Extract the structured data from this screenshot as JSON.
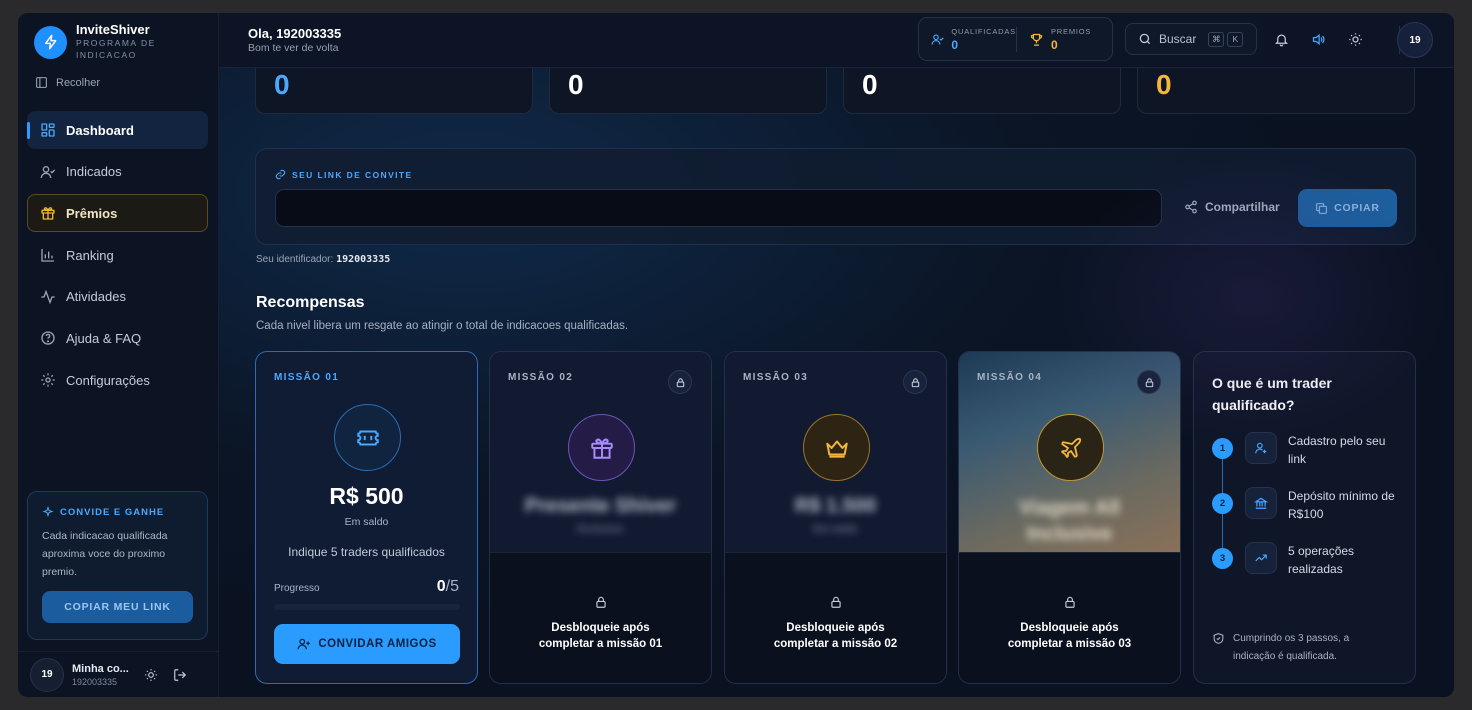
{
  "brand": {
    "name": "InviteShiver",
    "subtitle": "PROGRAMA DE INDICACAO"
  },
  "sidebar": {
    "collapse_label": "Recolher",
    "items": [
      {
        "label": "Dashboard",
        "icon": "grid-icon"
      },
      {
        "label": "Indicados",
        "icon": "user-check-icon"
      },
      {
        "label": "Prêmios",
        "icon": "gift-icon"
      },
      {
        "label": "Ranking",
        "icon": "bar-chart-icon"
      },
      {
        "label": "Atividades",
        "icon": "activity-icon"
      },
      {
        "label": "Ajuda & FAQ",
        "icon": "help-circle-icon"
      },
      {
        "label": "Configurações",
        "icon": "gear-icon"
      }
    ],
    "invite_box": {
      "title": "CONVIDE E GANHE",
      "text": "Cada indicacao qualificada aproxima voce do proximo premio.",
      "button": "COPIAR MEU LINK"
    },
    "footer": {
      "avatar": "19",
      "name": "Minha co...",
      "id": "192003335"
    }
  },
  "header": {
    "greeting": "Ola, 192003335",
    "subgreeting": "Bom te ver de volta",
    "stats": [
      {
        "label": "QUALIFICADAS",
        "value": "0",
        "color": "#4aa8ff"
      },
      {
        "label": "PREMIOS",
        "value": "0",
        "color": "#f5b73b"
      }
    ],
    "search": {
      "label": "Buscar",
      "kbd1": "⌘",
      "kbd2": "K"
    },
    "avatar": "19"
  },
  "top_cards": [
    {
      "value": "0",
      "color": "#4aa8ff"
    },
    {
      "value": "0",
      "color": "#ffffff"
    },
    {
      "value": "0",
      "color": "#ffffff"
    },
    {
      "value": "0",
      "color": "#f5b73b"
    }
  ],
  "invite_link": {
    "label": "SEU LINK DE CONVITE",
    "value": "",
    "share_label": "Compartilhar",
    "copy_label": "COPIAR",
    "identifier_label": "Seu identificador:",
    "identifier_value": "192003335"
  },
  "rewards": {
    "title": "Recompensas",
    "subtitle": "Cada nivel libera um resgate ao atingir o total de indicacoes qualificadas.",
    "missions": [
      {
        "label": "MISSÃO 01",
        "value": "R$ 500",
        "caption": "Em saldo",
        "desc": "Indique 5 traders qualificados",
        "progress_label": "Progresso",
        "progress_current": "0",
        "progress_total": "/5",
        "progress_fraction": 0,
        "button": "CONVIDAR AMIGOS"
      },
      {
        "label": "MISSÃO 02",
        "blur_title": "Presente Shiver",
        "blur_caption": "Exclusivo",
        "unlock_1": "Desbloqueie após",
        "unlock_2": "completar a missão 01"
      },
      {
        "label": "MISSÃO 03",
        "blur_title": "R$ 1.500",
        "blur_caption": "Em saldo",
        "unlock_1": "Desbloqueie após",
        "unlock_2": "completar a missão 02"
      },
      {
        "label": "MISSÃO 04",
        "blur_title": "Viagem All Inclusive",
        "blur_caption": "",
        "unlock_1": "Desbloqueie após",
        "unlock_2": "completar a missão 03"
      }
    ]
  },
  "qualified": {
    "title": "O que é um trader qualificado?",
    "steps": [
      {
        "num": "1",
        "text": "Cadastro pelo seu link",
        "icon": "user-icon"
      },
      {
        "num": "2",
        "text": "Depósito mínimo de R$100",
        "icon": "bank-icon"
      },
      {
        "num": "3",
        "text": "5 operações realizadas",
        "icon": "trending-up-icon"
      }
    ],
    "footer": "Cumprindo os 3 passos, a indicação é qualificada."
  },
  "colors": {
    "accent": "#2a9bff",
    "gold": "#f5b73b",
    "purple": "#9b7bff"
  }
}
